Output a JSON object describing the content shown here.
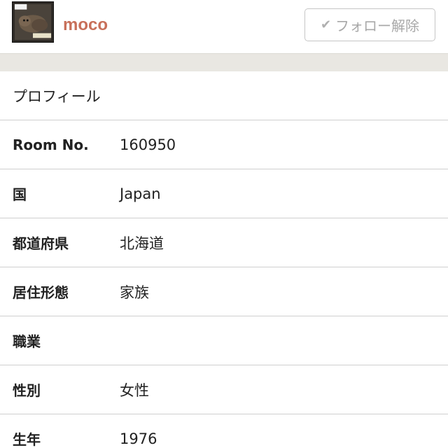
{
  "header": {
    "username": "moco",
    "avatar_caption": "moco",
    "avatar_date": "MARUKA 2016",
    "follow_button_label": "フォロー解除",
    "follow_button_icon": "check-icon"
  },
  "profile": {
    "heading": "プロフィール",
    "rows": [
      {
        "label": "Room No.",
        "value": "160950"
      },
      {
        "label": "国",
        "value": "Japan"
      },
      {
        "label": "都道府県",
        "value": "北海道"
      },
      {
        "label": "居住形態",
        "value": "家族"
      },
      {
        "label": "職業",
        "value": ""
      },
      {
        "label": "性別",
        "value": "女性"
      },
      {
        "label": "生年",
        "value": "1976"
      }
    ]
  },
  "colors": {
    "username": "#c8705a",
    "band": "#e9e7e2",
    "divider": "#cfcfcf",
    "button_border": "#c6c6c6",
    "button_text": "#a8a8a8"
  }
}
